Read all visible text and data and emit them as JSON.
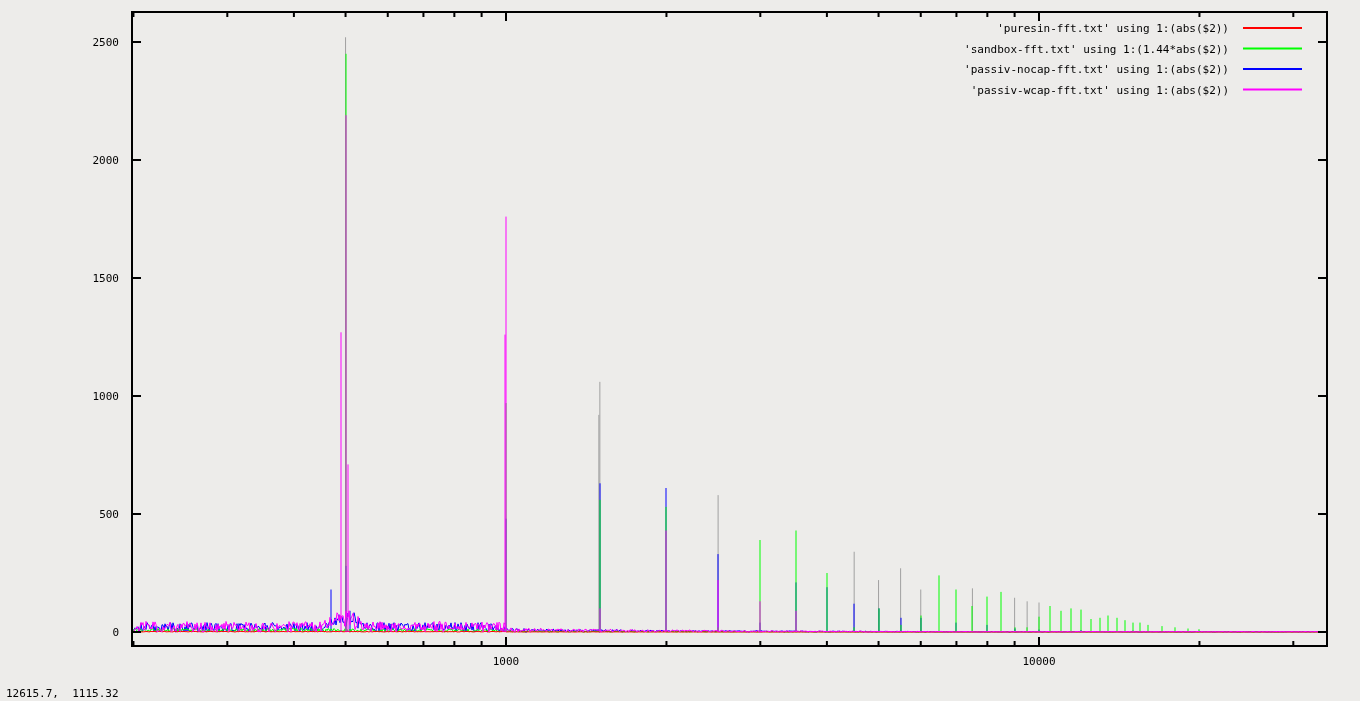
{
  "plot": {
    "y_tick_labels": [
      "2500",
      "2000",
      "1500",
      "1000",
      "500",
      "0"
    ],
    "x_tick_labels": [
      "1000",
      "10000"
    ],
    "legend": [
      {
        "label": "'puresin-fft.txt' using 1:(abs($2))",
        "color": "#ff0000"
      },
      {
        "label": "'sandbox-fft.txt' using 1:(1.44*abs($2))",
        "color": "#00ff00"
      },
      {
        "label": "'passiv-nocap-fft.txt' using 1:(abs($2))",
        "color": "#0000ff"
      },
      {
        "label": "'passiv-wcap-fft.txt' using 1:(abs($2))",
        "color": "#ff00ff"
      }
    ]
  },
  "status_bar": {
    "coordinates": "12615.7,  1115.32"
  }
}
